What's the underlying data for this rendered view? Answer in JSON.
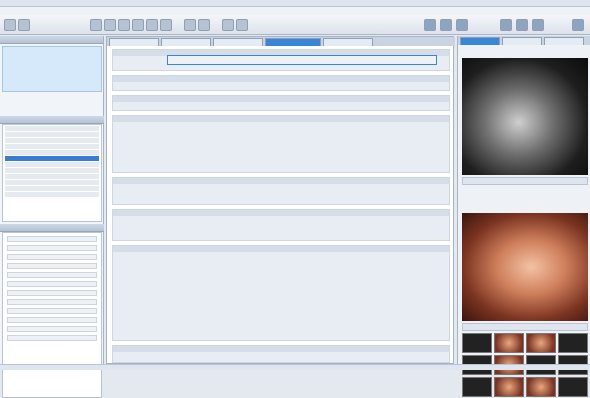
{
  "window": {
    "title": ""
  },
  "patient": {
    "name": "",
    "id": ""
  },
  "center": {
    "sections": []
  },
  "right": {
    "tabs": []
  }
}
